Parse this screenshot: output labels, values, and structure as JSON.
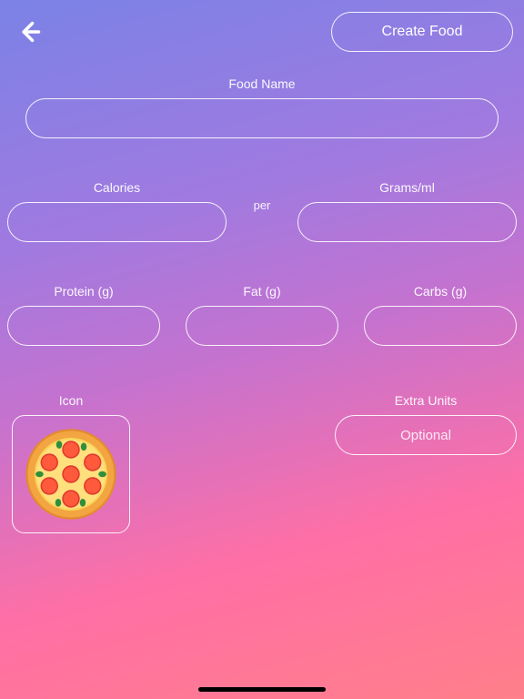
{
  "header": {
    "create_label": "Create Food"
  },
  "labels": {
    "food_name": "Food Name",
    "calories": "Calories",
    "per": "per",
    "grams_ml": "Grams/ml",
    "protein": "Protein (g)",
    "fat": "Fat (g)",
    "carbs": "Carbs (g)",
    "icon": "Icon",
    "extra_units": "Extra Units"
  },
  "values": {
    "food_name": "",
    "calories": "",
    "grams_ml": "",
    "protein": "",
    "fat": "",
    "carbs": "",
    "extra_units_placeholder": "Optional"
  }
}
